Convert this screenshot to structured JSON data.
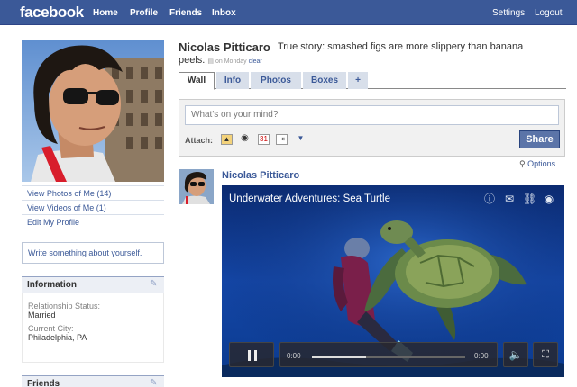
{
  "topbar": {
    "logo": "facebook",
    "nav": [
      "Home",
      "Profile",
      "Friends",
      "Inbox"
    ],
    "settings": "Settings",
    "logout": "Logout"
  },
  "profile": {
    "name": "Nicolas Pitticaro",
    "status_part1": "True story: smashed figs are more slippery than banana",
    "status_part2": "peels.",
    "status_time": "on Monday",
    "status_clear": "clear",
    "links": [
      "View Photos of Me (14)",
      "View Videos of Me (1)",
      "Edit My Profile"
    ],
    "write_something": "Write something about yourself.",
    "info_title": "Information",
    "relationship_label": "Relationship Status:",
    "relationship_value": "Married",
    "city_label": "Current City:",
    "city_value": "Philadelphia, PA",
    "friends_title": "Friends"
  },
  "tabs": [
    "Wall",
    "Info",
    "Photos",
    "Boxes",
    "+"
  ],
  "publisher": {
    "placeholder": "What's on your mind?",
    "attach_label": "Attach:",
    "share_label": "Share"
  },
  "options_label": "Options",
  "story": {
    "author": "Nicolas Pitticaro",
    "video_title": "Underwater Adventures: Sea Turtle",
    "time_current": "0:00",
    "time_end": "0:00",
    "progress": 0.35
  },
  "colors": {
    "brand": "#3b5998",
    "link": "#3b5998",
    "share_button": "#5b74a8"
  }
}
